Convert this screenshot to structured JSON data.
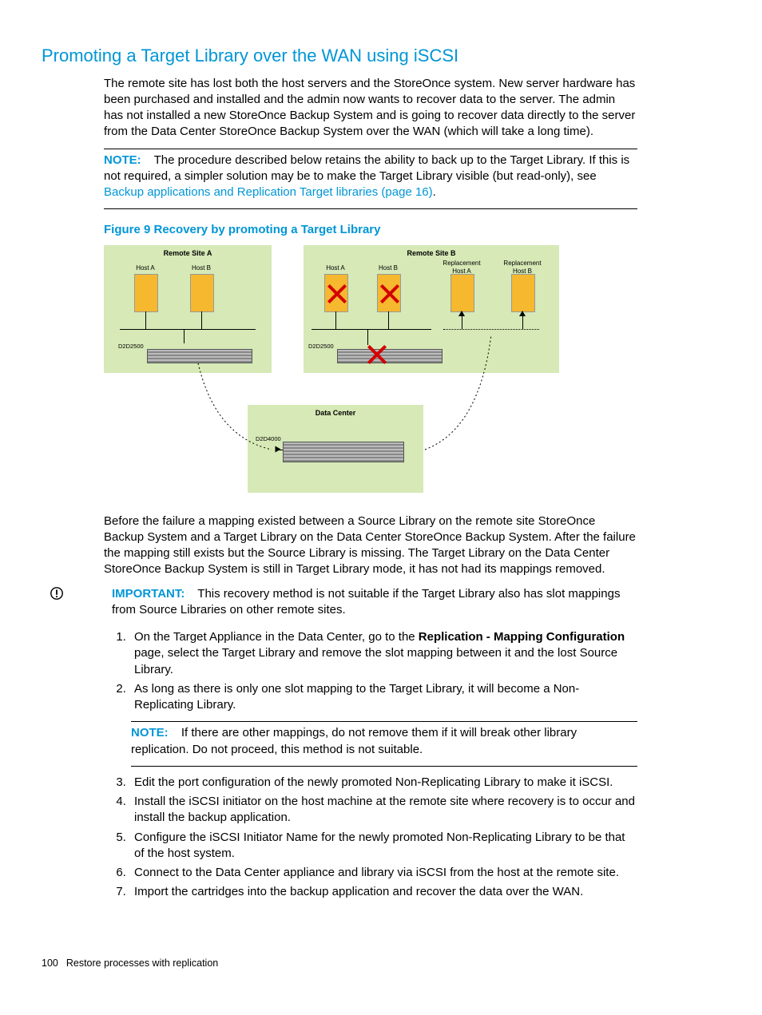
{
  "section_title": "Promoting a Target Library over the WAN using iSCSI",
  "intro_paragraph": "The remote site has lost both the host servers and the StoreOnce system. New server hardware has been purchased and installed and the admin now wants to recover data to the server. The admin has not installed a new StoreOnce Backup System and is going to recover data directly to the server from the Data Center StoreOnce Backup System over the WAN (which will take a long time).",
  "note1": {
    "label": "NOTE:",
    "text_before_link": "The procedure described below retains the ability to back up to the Target Library. If this is not required, a simpler solution may be to make the Target Library visible (but read-only), see ",
    "link_text": "Backup applications and Replication Target libraries (page 16)",
    "text_after_link": "."
  },
  "figure": {
    "caption": "Figure 9 Recovery by promoting a Target Library",
    "remote_a_title": "Remote Site A",
    "remote_b_title": "Remote Site B",
    "data_center_title": "Data Center",
    "host_a": "Host A",
    "host_b": "Host B",
    "repl_host_a": "Replacement Host A",
    "repl_host_b": "Replacement Host B",
    "d2d2500": "D2D2500",
    "d2d4000": "D2D4000"
  },
  "after_figure_paragraph": "Before the failure a mapping existed between a Source Library on the remote site StoreOnce Backup System and a Target Library on the Data Center StoreOnce Backup System. After the failure the mapping still exists but the Source Library is missing. The Target Library on the Data Center StoreOnce Backup System is still in Target Library mode, it has not had its mappings removed.",
  "important": {
    "label": "IMPORTANT:",
    "text": "This recovery method is not suitable if the Target Library also has slot mappings from Source Libraries on other remote sites."
  },
  "steps": {
    "s1a": "On the Target Appliance in the Data Center, go to the ",
    "s1b_bold": "Replication - Mapping Configuration",
    "s1c": " page, select the Target Library and remove the slot mapping between it and the lost Source Library.",
    "s2": "As long as there is only one slot mapping to the Target Library, it will become a Non-Replicating Library.",
    "inner_note_label": "NOTE:",
    "inner_note_text": "If there are other mappings, do not remove them if it will break other library replication. Do not proceed, this method is not suitable.",
    "s3": "Edit the port configuration of the newly promoted Non-Replicating Library to make it iSCSI.",
    "s4": "Install the iSCSI initiator on the host machine at the remote site where recovery is to occur and install the backup application.",
    "s5": "Configure the iSCSI Initiator Name for the newly promoted Non-Replicating Library to be that of the host system.",
    "s6": "Connect to the Data Center appliance and library via iSCSI from the host at the remote site.",
    "s7": "Import the cartridges into the backup application and recover the data over the WAN."
  },
  "footer": {
    "page_number": "100",
    "chapter": "Restore processes with replication"
  }
}
